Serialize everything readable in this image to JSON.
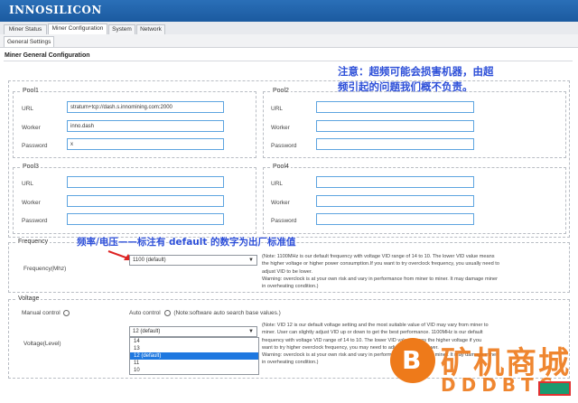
{
  "header": {
    "logo": "INNOSILICON",
    "brand_color": "#1f63ad"
  },
  "tabs": [
    {
      "label": "Miner Status"
    },
    {
      "label": "Miner Configuration",
      "active": true
    },
    {
      "label": "System"
    },
    {
      "label": "Network"
    }
  ],
  "subtab": {
    "label": "General Settings"
  },
  "page": {
    "title": "Miner General Configuration"
  },
  "annotations": {
    "warning_line1": "注意：超频可能会损害机器，由超",
    "warning_line2": "频引起的问题我们概不负责。",
    "freq_note": "频率/电压——标注有 default 的数字为出厂标准值",
    "note_color": "#2d4fd8"
  },
  "labels": {
    "url": "URL",
    "worker": "Worker",
    "password": "Password"
  },
  "pools": [
    {
      "legend": "Pool1",
      "url": "stratum+tcp://dash.s.innomining.com:2000",
      "worker": "inno.dash",
      "password": "x"
    },
    {
      "legend": "Pool2",
      "url": "",
      "worker": "",
      "password": ""
    },
    {
      "legend": "Pool3",
      "url": "",
      "worker": "",
      "password": ""
    },
    {
      "legend": "Pool4",
      "url": "",
      "worker": "",
      "password": ""
    }
  ],
  "frequency": {
    "legend": "Frequency",
    "label": "Frequency(Mhz)",
    "value": "1100 (default)",
    "description": [
      "(Note: 1100MHz is our default frequency with voltage VID range of 14 to 10. The lower VID value means",
      "the higher voltage or higher power consumption.If you want to try overclock frequency, you usually need to",
      "adjust VID to be lower.",
      "Warning: overclock is at your own risk and vary in performance from miner to miner. It may damage miner",
      "in overheating condition.)"
    ]
  },
  "voltage": {
    "legend": "Voltage",
    "manual_label": "Manual control",
    "auto_label": "Auto control",
    "auto_note": "(Note:software auto search base values.)",
    "label": "Voltage(Level)",
    "value": "12 (default)",
    "options": [
      "14",
      "13",
      "12 (default)",
      "11",
      "10"
    ],
    "selected_index": 2,
    "description": [
      "(Note: VID 12 is our default voltage setting and the most suitable value of VID may vary from miner to",
      "miner. User can slightly adjust VID up or down to get the best performance. 1100MHz is our default",
      "frequency with voltage VID range of 14 to 10. The lower VID value means the higher voltage if you",
      "want to try higher overclock frequency, you may need to adjust VID to be lower.",
      "Warning: overclock is at your own risk and vary in performance from miner to miner. It may damage miner",
      "in overheating condition.)"
    ]
  },
  "watermark": {
    "cn": "矿机商城",
    "en": "DDDBTC",
    "color": "#ee7a1a"
  }
}
